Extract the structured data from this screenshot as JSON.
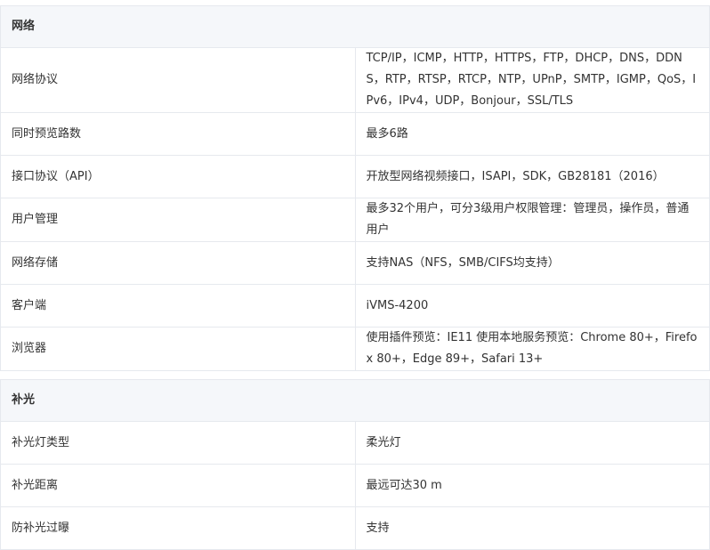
{
  "sections": [
    {
      "title": "网络",
      "rows": [
        {
          "key": "网络协议",
          "value": "TCP/IP，ICMP，HTTP，HTTPS，FTP，DHCP，DNS，DDNS，RTP，RTSP，RTCP，NTP，UPnP，SMTP，IGMP，QoS，IPv6，IPv4，UDP，Bonjour，SSL/TLS"
        },
        {
          "key": "同时预览路数",
          "value": "最多6路"
        },
        {
          "key": "接口协议（API）",
          "value": "开放型网络视频接口，ISAPI，SDK，GB28181（2016）"
        },
        {
          "key": "用户管理",
          "value": "最多32个用户，可分3级用户权限管理：管理员，操作员，普通用户"
        },
        {
          "key": "网络存储",
          "value": "支持NAS（NFS，SMB/CIFS均支持）"
        },
        {
          "key": "客户端",
          "value": "iVMS-4200"
        },
        {
          "key": "浏览器",
          "value": "使用插件预览：IE11 使用本地服务预览：Chrome 80+，Firefox 80+，Edge 89+，Safari 13+"
        }
      ]
    },
    {
      "title": "补光",
      "rows": [
        {
          "key": "补光灯类型",
          "value": "柔光灯"
        },
        {
          "key": "补光距离",
          "value": "最远可达30 m"
        },
        {
          "key": "防补光过曝",
          "value": "支持"
        }
      ]
    }
  ]
}
